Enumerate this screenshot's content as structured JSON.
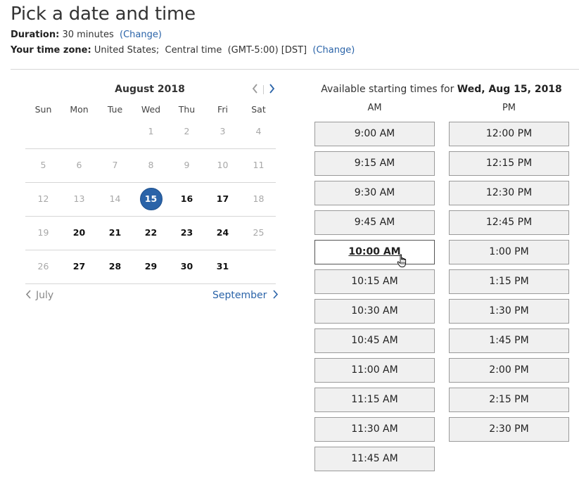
{
  "header": {
    "title": "Pick a date and time",
    "duration_label": "Duration:",
    "duration_value": "30 minutes",
    "duration_change_open": "(",
    "duration_change": "Change",
    "duration_change_close": ")",
    "tz_label": "Your time zone:",
    "tz_value": "United States;  Central time  (GMT-5:00) [DST]",
    "tz_change_open": "(",
    "tz_change": "Change",
    "tz_change_close": ")"
  },
  "calendar": {
    "month_label": "August 2018",
    "prev_icon": "chevron-left-icon",
    "next_icon": "chevron-right-icon",
    "weekdays": [
      "Sun",
      "Mon",
      "Tue",
      "Wed",
      "Thu",
      "Fri",
      "Sat"
    ],
    "weeks": [
      [
        {
          "d": ""
        },
        {
          "d": ""
        },
        {
          "d": ""
        },
        {
          "d": "1",
          "s": "dis"
        },
        {
          "d": "2",
          "s": "dis"
        },
        {
          "d": "3",
          "s": "dis"
        },
        {
          "d": "4",
          "s": "dis"
        }
      ],
      [
        {
          "d": "5",
          "s": "dis"
        },
        {
          "d": "6",
          "s": "dis"
        },
        {
          "d": "7",
          "s": "dis"
        },
        {
          "d": "8",
          "s": "dis"
        },
        {
          "d": "9",
          "s": "dis"
        },
        {
          "d": "10",
          "s": "dis"
        },
        {
          "d": "11",
          "s": "dis"
        }
      ],
      [
        {
          "d": "12",
          "s": "dis"
        },
        {
          "d": "13",
          "s": "dis"
        },
        {
          "d": "14",
          "s": "dis"
        },
        {
          "d": "15",
          "s": "sel"
        },
        {
          "d": "16",
          "s": "avail"
        },
        {
          "d": "17",
          "s": "avail"
        },
        {
          "d": "18",
          "s": "dis"
        }
      ],
      [
        {
          "d": "19",
          "s": "dis"
        },
        {
          "d": "20",
          "s": "avail"
        },
        {
          "d": "21",
          "s": "avail"
        },
        {
          "d": "22",
          "s": "avail"
        },
        {
          "d": "23",
          "s": "avail"
        },
        {
          "d": "24",
          "s": "avail"
        },
        {
          "d": "25",
          "s": "dis"
        }
      ],
      [
        {
          "d": "26",
          "s": "dis"
        },
        {
          "d": "27",
          "s": "avail"
        },
        {
          "d": "28",
          "s": "avail"
        },
        {
          "d": "29",
          "s": "avail"
        },
        {
          "d": "30",
          "s": "avail"
        },
        {
          "d": "31",
          "s": "avail"
        },
        {
          "d": ""
        }
      ]
    ],
    "prev_month": "July",
    "next_month": "September"
  },
  "times": {
    "heading_prefix": "Available starting times for",
    "heading_date": "Wed, Aug 15, 2018",
    "am_label": "AM",
    "pm_label": "PM",
    "am": [
      "9:00 AM",
      "9:15 AM",
      "9:30 AM",
      "9:45 AM",
      "10:00 AM",
      "10:15 AM",
      "10:30 AM",
      "10:45 AM",
      "11:00 AM",
      "11:15 AM",
      "11:30 AM",
      "11:45 AM"
    ],
    "pm": [
      "12:00 PM",
      "12:15 PM",
      "12:30 PM",
      "12:45 PM",
      "1:00 PM",
      "1:15 PM",
      "1:30 PM",
      "1:45 PM",
      "2:00 PM",
      "2:15 PM",
      "2:30 PM"
    ],
    "hovered": "10:00 AM"
  },
  "colors": {
    "link": "#2a63a8",
    "selected_day": "#2a63a8"
  }
}
